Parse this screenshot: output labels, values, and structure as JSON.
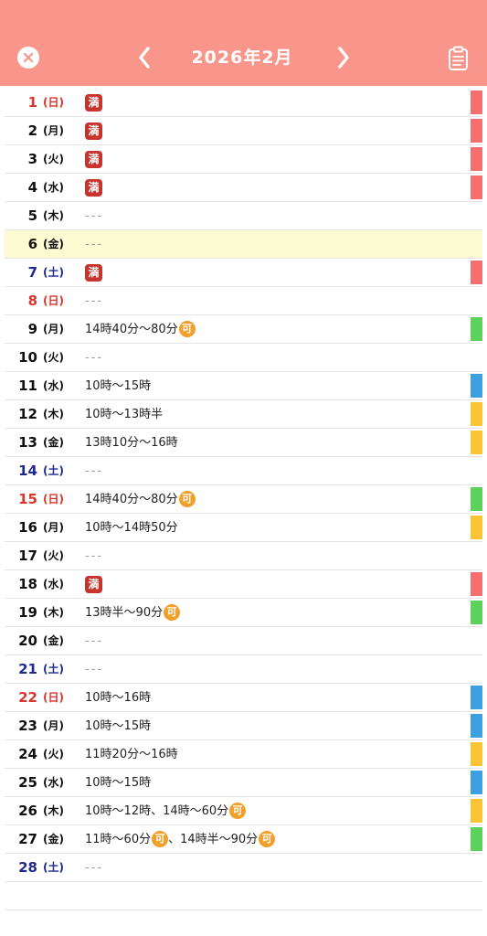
{
  "header": {
    "title": "2026年2月",
    "close_icon": "close-circle-icon",
    "prev_icon": "chevron-left-icon",
    "next_icon": "chevron-right-icon",
    "memo_icon": "clipboard-icon",
    "background": "#f9968b"
  },
  "labels": {
    "full": "満",
    "ok": "可",
    "none": "---"
  },
  "colors": {
    "red": "#f56f6f",
    "green": "#5bd25b",
    "blue": "#3d9fe0",
    "yellow": "#fbc434",
    "sunday": "#d9352c",
    "saturday": "#1f2a8f",
    "highlight": "#fdfbd2"
  },
  "days": [
    {
      "day": "1",
      "dow": "(日)",
      "type": "sun",
      "status": "full",
      "bar": "red"
    },
    {
      "day": "2",
      "dow": "(月)",
      "type": "wd",
      "status": "full",
      "bar": "red"
    },
    {
      "day": "3",
      "dow": "(火)",
      "type": "wd",
      "status": "full",
      "bar": "red"
    },
    {
      "day": "4",
      "dow": "(水)",
      "type": "wd",
      "status": "full",
      "bar": "red"
    },
    {
      "day": "5",
      "dow": "(木)",
      "type": "wd",
      "status": "none"
    },
    {
      "day": "6",
      "dow": "(金)",
      "type": "wd",
      "status": "none",
      "highlight": true
    },
    {
      "day": "7",
      "dow": "(土)",
      "type": "sat",
      "status": "full",
      "bar": "red"
    },
    {
      "day": "8",
      "dow": "(日)",
      "type": "sun",
      "status": "none"
    },
    {
      "day": "9",
      "dow": "(月)",
      "type": "wd",
      "status": "text",
      "parts": [
        {
          "t": "14時40分〜80分",
          "ka": true
        }
      ],
      "bar": "green"
    },
    {
      "day": "10",
      "dow": "(火)",
      "type": "wd",
      "status": "none"
    },
    {
      "day": "11",
      "dow": "(水)",
      "type": "wd",
      "status": "text",
      "parts": [
        {
          "t": "10時〜15時",
          "ka": false
        }
      ],
      "bar": "blue"
    },
    {
      "day": "12",
      "dow": "(木)",
      "type": "wd",
      "status": "text",
      "parts": [
        {
          "t": "10時〜13時半",
          "ka": false
        }
      ],
      "bar": "yellow"
    },
    {
      "day": "13",
      "dow": "(金)",
      "type": "wd",
      "status": "text",
      "parts": [
        {
          "t": "13時10分〜16時",
          "ka": false
        }
      ],
      "bar": "yellow"
    },
    {
      "day": "14",
      "dow": "(土)",
      "type": "sat",
      "status": "none"
    },
    {
      "day": "15",
      "dow": "(日)",
      "type": "sun",
      "status": "text",
      "parts": [
        {
          "t": "14時40分〜80分",
          "ka": true
        }
      ],
      "bar": "green"
    },
    {
      "day": "16",
      "dow": "(月)",
      "type": "wd",
      "status": "text",
      "parts": [
        {
          "t": "10時〜14時50分",
          "ka": false
        }
      ],
      "bar": "yellow"
    },
    {
      "day": "17",
      "dow": "(火)",
      "type": "wd",
      "status": "none"
    },
    {
      "day": "18",
      "dow": "(水)",
      "type": "wd",
      "status": "full",
      "bar": "red"
    },
    {
      "day": "19",
      "dow": "(木)",
      "type": "wd",
      "status": "text",
      "parts": [
        {
          "t": "13時半〜90分",
          "ka": true
        }
      ],
      "bar": "green"
    },
    {
      "day": "20",
      "dow": "(金)",
      "type": "wd",
      "status": "none"
    },
    {
      "day": "21",
      "dow": "(土)",
      "type": "sat",
      "status": "none"
    },
    {
      "day": "22",
      "dow": "(日)",
      "type": "sun",
      "status": "text",
      "parts": [
        {
          "t": "10時〜16時",
          "ka": false
        }
      ],
      "bar": "blue"
    },
    {
      "day": "23",
      "dow": "(月)",
      "type": "wd",
      "status": "text",
      "parts": [
        {
          "t": "10時〜15時",
          "ka": false
        }
      ],
      "bar": "blue"
    },
    {
      "day": "24",
      "dow": "(火)",
      "type": "wd",
      "status": "text",
      "parts": [
        {
          "t": "11時20分〜16時",
          "ka": false
        }
      ],
      "bar": "yellow"
    },
    {
      "day": "25",
      "dow": "(水)",
      "type": "wd",
      "status": "text",
      "parts": [
        {
          "t": "10時〜15時",
          "ka": false
        }
      ],
      "bar": "blue"
    },
    {
      "day": "26",
      "dow": "(木)",
      "type": "wd",
      "status": "text",
      "parts": [
        {
          "t": "10時〜12時、14時〜60分",
          "ka": true
        }
      ],
      "bar": "yellow"
    },
    {
      "day": "27",
      "dow": "(金)",
      "type": "wd",
      "status": "text",
      "parts": [
        {
          "t": "11時〜60分",
          "ka": true
        },
        {
          "t": "、14時半〜90分",
          "ka": true
        }
      ],
      "bar": "green"
    },
    {
      "day": "28",
      "dow": "(土)",
      "type": "sat",
      "status": "none"
    }
  ]
}
